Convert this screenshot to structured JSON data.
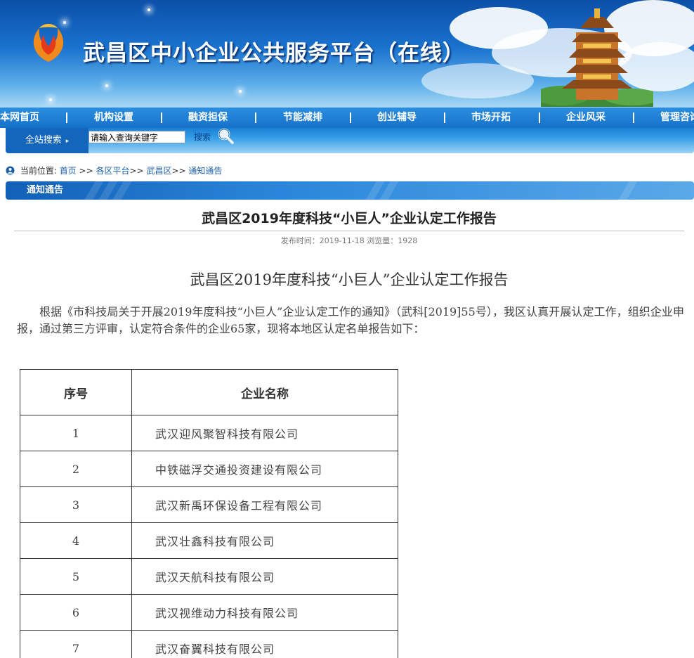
{
  "header": {
    "site_title": "武昌区中小企业公共服务平台（在线）",
    "logo_icon": "phoenix-logo-icon",
    "tower_icon": "yellow-crane-tower-icon"
  },
  "nav": {
    "items": [
      "本网首页",
      "机构设置",
      "融资担保",
      "节能减排",
      "创业辅导",
      "市场开拓",
      "企业风采",
      "管理咨询"
    ],
    "separator": "|"
  },
  "search": {
    "label": "全站搜索",
    "placeholder": "请输入查询关键字",
    "value": "请输入查询关键字",
    "button_label": "搜索"
  },
  "breadcrumb": {
    "prefix": "当前位置:",
    "items": [
      "首页",
      "各区平台",
      "武昌区",
      "通知通告"
    ],
    "sep": ">>"
  },
  "section": {
    "title": "通知通告"
  },
  "article": {
    "title": "武昌区2019年度科技“小巨人”企业认定工作报告",
    "meta": "发布时间：2019-11-18 浏览量：1928",
    "body_title": "武昌区2019年度科技“小巨人”企业认定工作报告",
    "paragraph": "根据《市科技局关于开展2019年度科技“小巨人”企业认定工作的通知》（武科[2019]55号），我区认真开展认定工作，组织企业申报，通过第三方评审，认定符合条件的企业65家，现将本地区认定名单报告如下："
  },
  "table": {
    "headers": [
      "序号",
      "企业名称"
    ],
    "rows": [
      [
        "1",
        "武汉迎风聚智科技有限公司"
      ],
      [
        "2",
        "中铁磁浮交通投资建设有限公司"
      ],
      [
        "3",
        "武汉新禹环保设备工程有限公司"
      ],
      [
        "4",
        "武汉壮鑫科技有限公司"
      ],
      [
        "5",
        "武汉天航科技有限公司"
      ],
      [
        "6",
        "武汉视维动力科技有限公司"
      ],
      [
        "7",
        "武汉奋翼科技有限公司"
      ]
    ]
  },
  "colors": {
    "banner_top": "#0b4fa8",
    "nav_bg": "#1672c9",
    "accent_blue": "#1b5ea8",
    "section_bar": "#2a86da"
  }
}
